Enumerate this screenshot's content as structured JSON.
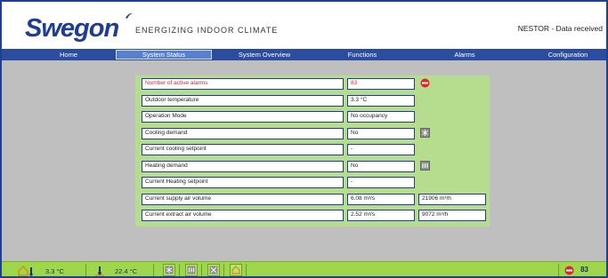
{
  "header": {
    "logo_text": "Swegon",
    "tagline": "ENERGIZING INDOOR CLIMATE",
    "connection_status": "NESTOR - Data received"
  },
  "nav": {
    "tabs": [
      {
        "label": "Home",
        "active": false
      },
      {
        "label": "System Status",
        "active": true
      },
      {
        "label": "System Overview",
        "active": false
      },
      {
        "label": "Functions",
        "active": false
      },
      {
        "label": "Alarms",
        "active": false
      },
      {
        "label": "Configuration",
        "active": false
      }
    ]
  },
  "status": {
    "rows": [
      {
        "label": "Number of active alarms",
        "value": "83",
        "value2": null,
        "icon": "alarm-stop-icon",
        "alarm": true
      },
      {
        "label": "Outdoor temperature",
        "value": "3.3 °C",
        "value2": null,
        "icon": null,
        "alarm": false
      },
      {
        "label": "Operation Mode",
        "value": "No occupancy",
        "value2": null,
        "icon": null,
        "alarm": false
      },
      {
        "label": "Cooling demand",
        "value": "No",
        "value2": null,
        "icon": "cooling-icon",
        "alarm": false
      },
      {
        "label": "Current cooling setpoint",
        "value": "-",
        "value2": null,
        "icon": null,
        "alarm": false
      },
      {
        "label": "Heating demand",
        "value": "No",
        "value2": null,
        "icon": "heating-icon",
        "alarm": false
      },
      {
        "label": "Current Heating setpoint",
        "value": "-",
        "value2": null,
        "icon": null,
        "alarm": false
      },
      {
        "label": "Current supply air volume",
        "value": "6.08 m³/s",
        "value2": "21906 m³/h",
        "icon": null,
        "alarm": false
      },
      {
        "label": "Current extract air volume",
        "value": "2.52 m³/s",
        "value2": "9072 m³/h",
        "icon": null,
        "alarm": false
      }
    ]
  },
  "footer": {
    "outdoor_temp": "3.3 °C",
    "indoor_temp": "22.4 °C",
    "alarm_count": "83"
  },
  "colors": {
    "brand_blue": "#1e3c96",
    "nav_blue": "#2b4c9f",
    "panel_green": "#b6dd8e",
    "footer_green": "#9fd64a",
    "alarm_red": "#e0242b"
  }
}
